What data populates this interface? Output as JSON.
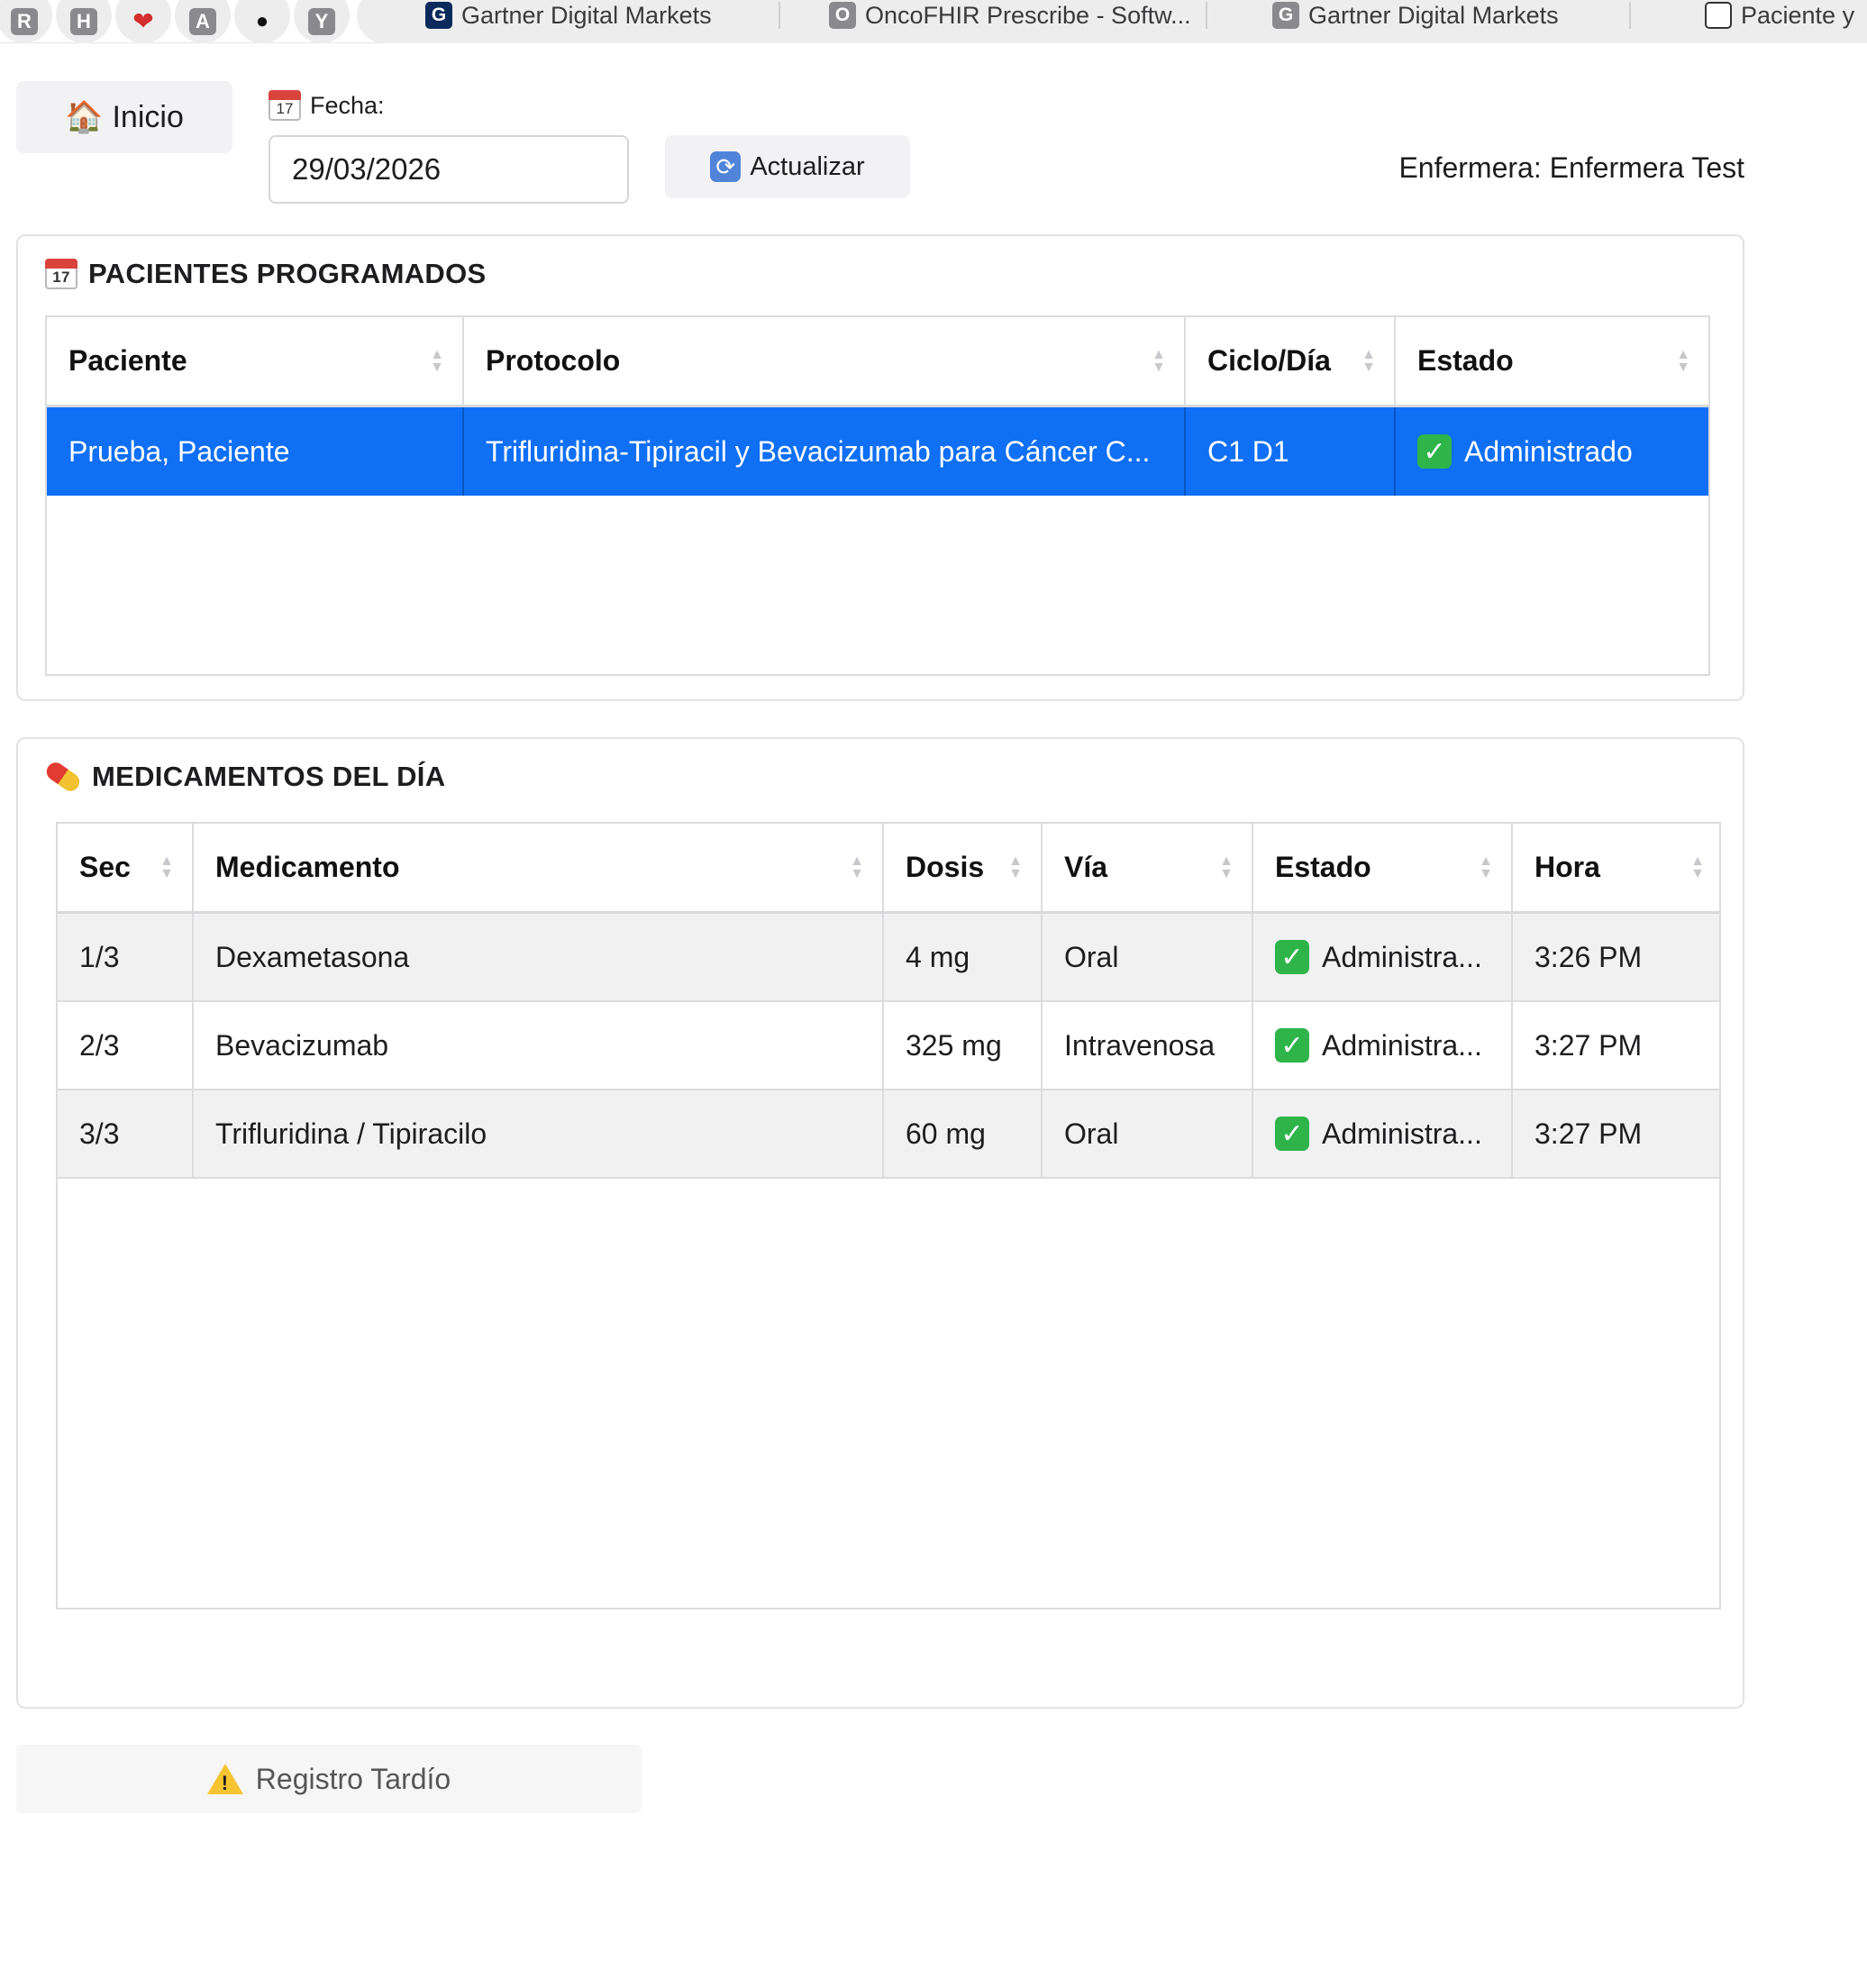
{
  "browser": {
    "pinned_tabs": [
      {
        "icon": "r-badge-icon",
        "glyph": "R"
      },
      {
        "icon": "h-badge-icon",
        "glyph": "H"
      },
      {
        "icon": "apple-red-icon",
        "glyph": ""
      },
      {
        "icon": "a-badge-icon",
        "glyph": "A"
      },
      {
        "icon": "apple-logo-icon",
        "glyph": ""
      },
      {
        "icon": "y-badge-icon",
        "glyph": "Y"
      }
    ],
    "tabs": [
      {
        "favicon": "G",
        "title": "Gartner Digital Markets"
      },
      {
        "favicon": "O",
        "title": "OncoFHIR Prescribe - Softw..."
      },
      {
        "favicon": "G",
        "title": "Gartner Digital Markets"
      },
      {
        "favicon": "",
        "title": "Paciente y"
      }
    ]
  },
  "toolbar": {
    "home_label": "Inicio",
    "date_label": "Fecha:",
    "date_value": "29/03/2026",
    "refresh_label": "Actualizar",
    "nurse_text": "Enfermera: Enfermera Test"
  },
  "patients": {
    "title": "PACIENTES PROGRAMADOS",
    "columns": [
      "Paciente",
      "Protocolo",
      "Ciclo/Día",
      "Estado"
    ],
    "rows": [
      {
        "paciente": "Prueba, Paciente",
        "protocolo": "Trifluridina-Tipiracil y Bevacizumab para Cáncer C...",
        "ciclo_dia": "C1 D1",
        "estado": "Administrado",
        "selected": true
      }
    ]
  },
  "medications": {
    "title": "MEDICAMENTOS DEL DÍA",
    "columns": [
      "Sec",
      "Medicamento",
      "Dosis",
      "Vía",
      "Estado",
      "Hora"
    ],
    "rows": [
      {
        "sec": "1/3",
        "medicamento": "Dexametasona",
        "dosis": "4 mg",
        "via": "Oral",
        "estado": "Administra...",
        "hora": "3:26 PM"
      },
      {
        "sec": "2/3",
        "medicamento": "Bevacizumab",
        "dosis": "325 mg",
        "via": "Intravenosa",
        "estado": "Administra...",
        "hora": "3:27 PM"
      },
      {
        "sec": "3/3",
        "medicamento": "Trifluridina / Tipiracilo",
        "dosis": "60 mg",
        "via": "Oral",
        "estado": "Administra...",
        "hora": "3:27 PM"
      }
    ]
  },
  "late_entry_label": "Registro Tardío",
  "colors": {
    "selection": "#0f6ff5",
    "check": "#2fb44a",
    "stripe": "#f1f1f1"
  }
}
